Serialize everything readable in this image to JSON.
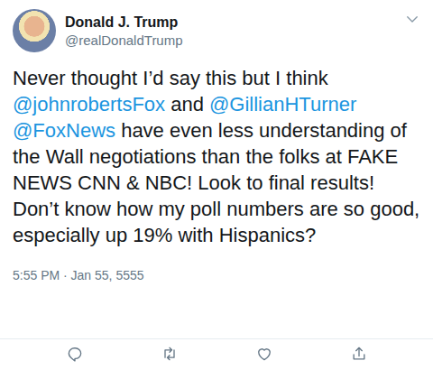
{
  "user": {
    "name": "Donald J. Trump",
    "handle": "@realDonaldTrump"
  },
  "tweet": {
    "segments": [
      {
        "kind": "text",
        "text": "Never thought I’d say this but I think "
      },
      {
        "kind": "mention",
        "text": "@johnrobertsFox"
      },
      {
        "kind": "text",
        "text": " and "
      },
      {
        "kind": "mention",
        "text": "@GillianHTurner"
      },
      {
        "kind": "text",
        "text": " "
      },
      {
        "kind": "mention",
        "text": "@FoxNews"
      },
      {
        "kind": "text",
        "text": " have even less understanding of the Wall negotiations than the folks at FAKE NEWS CNN & NBC! Look to final results! Don’t know how my poll numbers are so good, especially up 19% with Hispanics?"
      }
    ]
  },
  "timestamp": "5:55 PM · Jan 55, 5555"
}
